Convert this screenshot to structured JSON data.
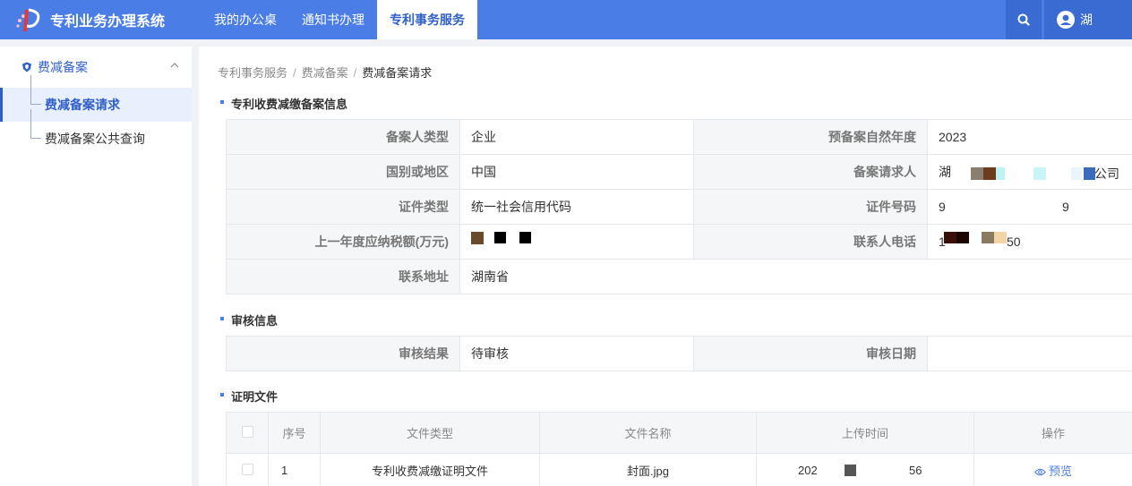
{
  "header": {
    "app_title": "专利业务办理系统",
    "nav": [
      {
        "label": "我的办公桌"
      },
      {
        "label": "通知书办理"
      },
      {
        "label": "专利事务服务"
      }
    ],
    "user_name": "湖"
  },
  "sidebar": {
    "group_label": "费减备案",
    "items": [
      {
        "label": "费减备案请求"
      },
      {
        "label": "费减备案公共查询"
      }
    ]
  },
  "breadcrumb": [
    "专利事务服务",
    "费减备案",
    "费减备案请求"
  ],
  "filing_section": {
    "title": "专利收费减缴备案信息",
    "rows": [
      {
        "l1": "备案人类型",
        "v1": "企业",
        "l2": "预备案自然年度",
        "v2": "2023"
      },
      {
        "l1": "国别或地区",
        "v1": "中国",
        "l2": "备案请求人",
        "v2_prefix": "湖",
        "v2_suffix": "公司"
      },
      {
        "l1": "证件类型",
        "v1": "统一社会信用代码",
        "l2": "证件号码",
        "v2_prefix": "9",
        "v2_suffix": "9"
      },
      {
        "l1": "上一年度应纳税额(万元)",
        "v1": "",
        "l2": "联系人电话",
        "v2_prefix": "1",
        "v2_suffix": "50"
      },
      {
        "l1": "联系地址",
        "v1": "湖南省"
      }
    ]
  },
  "review_section": {
    "title": "审核信息",
    "result_label": "审核结果",
    "result_value": "待审核",
    "date_label": "审核日期",
    "date_value": ""
  },
  "files_section": {
    "title": "证明文件",
    "columns": [
      "序号",
      "文件类型",
      "文件名称",
      "上传时间",
      "操作"
    ],
    "rows": [
      {
        "index": "1",
        "type": "专利收费减缴证明文件",
        "name": "封面.jpg",
        "time_prefix": "202",
        "time_suffix": "56",
        "action": "预览"
      }
    ]
  },
  "colors": {
    "header_bg": "#4a7de6",
    "accent": "#2f5fc9"
  }
}
